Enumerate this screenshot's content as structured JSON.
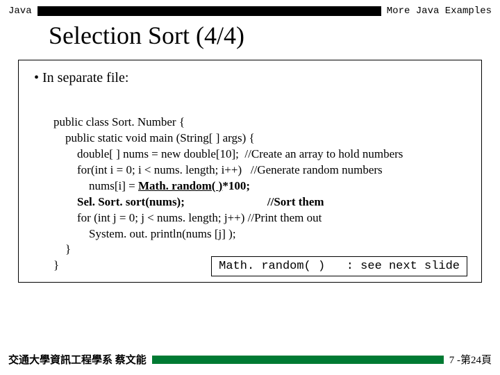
{
  "header": {
    "left": "Java",
    "right": "More Java Examples"
  },
  "title": "Selection Sort (4/4)",
  "bullet": "•  In separate file:",
  "code": {
    "l1": "public class Sort. Number {",
    "l2": "    public static void main (String[ ] args) {",
    "l3": "        double[ ] nums = new double[10];  //Create an array to hold numbers",
    "l4": "        for(int i = 0; i < nums. length; i++)   //Generate random numbers",
    "l5a": "            nums[i] = ",
    "l5b": "Math. random( )",
    "l5c": "*100;",
    "l6": "        Sel. Sort. sort(nums);                            //Sort them",
    "l7": "        for (int j = 0; j < nums. length; j++) //Print them out",
    "l8": "            System. out. println(nums [j] );",
    "l9": "    }",
    "l10": "}"
  },
  "note": "Math. random( )   : see next slide",
  "footer": {
    "left": "交通大學資訊工程學系 蔡文能",
    "right": "7 -第24頁"
  }
}
